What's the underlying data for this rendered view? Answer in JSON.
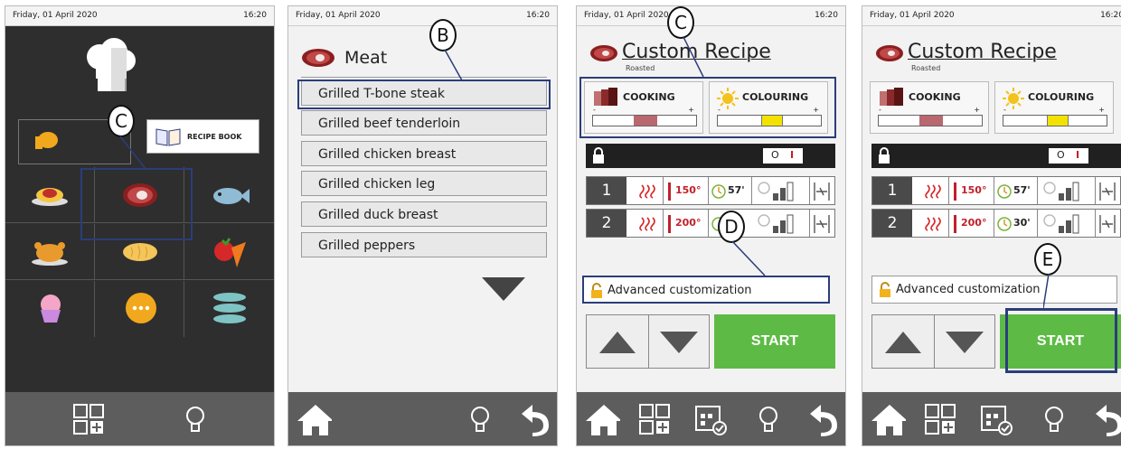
{
  "status": {
    "date": "Friday, 01 April 2020",
    "time": "16:20"
  },
  "panel1": {
    "recipe_book_label": "RECIPE BOOK",
    "callout": "C",
    "categories": [
      "pasta-icon",
      "meat-icon",
      "fish-icon",
      "poultry-icon",
      "bread-icon",
      "vegetables-icon",
      "dessert-icon",
      "more-icon",
      "plates-icon"
    ]
  },
  "panel2": {
    "title": "Meat",
    "callout": "B",
    "items": [
      "Grilled T-bone steak",
      "Grilled beef tenderloin",
      "Grilled chicken breast",
      "Grilled chicken leg",
      "Grilled duck breast",
      "Grilled peppers"
    ]
  },
  "recipe": {
    "title": "Custom Recipe",
    "subtitle": "Roasted",
    "cooking_label": "COOKING",
    "colouring_label": "COLOURING",
    "minus": "-",
    "plus": "+",
    "toggle_off": "O",
    "toggle_on": "I",
    "advanced_label": "Advanced customization",
    "start_label": "START",
    "phases_p3": [
      {
        "num": "1",
        "temp": "150°",
        "time": "57'"
      },
      {
        "num": "2",
        "temp": "200°",
        "time": ""
      }
    ],
    "phases_p4": [
      {
        "num": "1",
        "temp": "150°",
        "time": "57'"
      },
      {
        "num": "2",
        "temp": "200°",
        "time": "30'"
      }
    ]
  },
  "callouts": {
    "p3_c": "C",
    "p3_d": "D",
    "p4_e": "E"
  },
  "colors": {
    "start_green": "#5dbb45",
    "highlight_blue": "#2b3d7a",
    "temp_red": "#c0202a",
    "cooking_level": "#b9686f",
    "colouring_level": "#f3e200"
  }
}
